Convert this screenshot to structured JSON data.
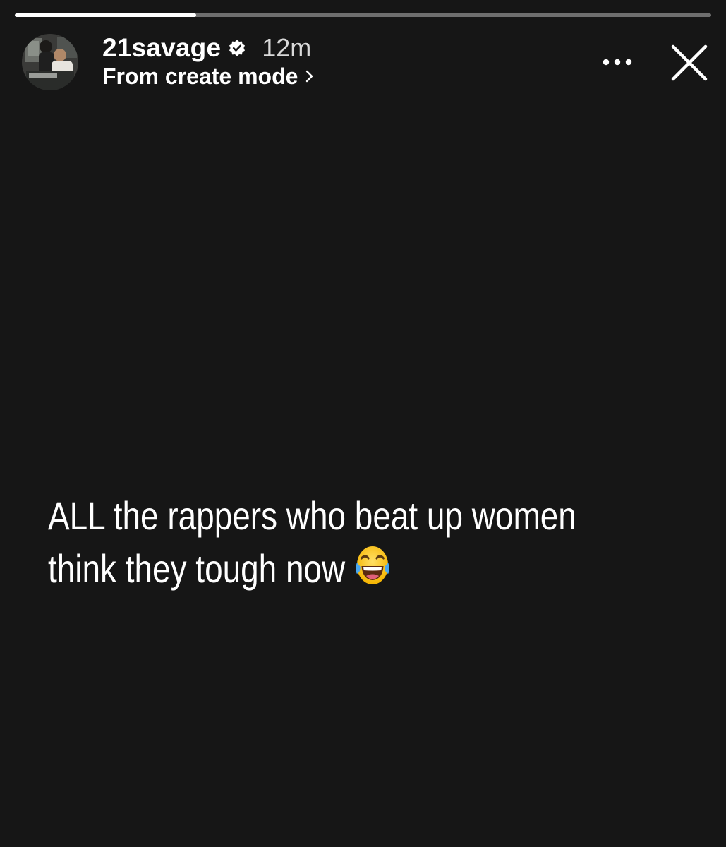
{
  "story": {
    "progress": 0.26,
    "username": "21savage",
    "verified": true,
    "time_ago": "12m",
    "source_label": "From create mode",
    "lines": [
      "ALL the rappers who beat up women",
      "think they tough now"
    ],
    "emoji": "face-with-tears-of-joy"
  },
  "icons": {
    "avatar": "profile-photo",
    "verified": "verified-badge-icon",
    "chevron": "chevron-right-icon",
    "more": "more-options-icon",
    "close": "close-icon"
  },
  "colors": {
    "background": "#161616",
    "text": "#ffffff",
    "time": "#d9d9d9",
    "progress_track": "rgba(255,255,255,0.38)"
  }
}
